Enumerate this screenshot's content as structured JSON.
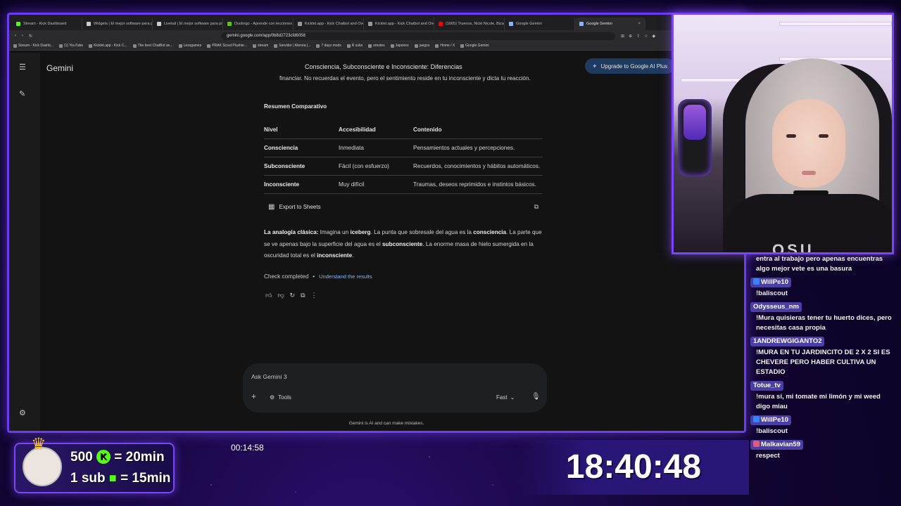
{
  "browser": {
    "tabs": [
      {
        "label": "Stream - Kick Dashboard",
        "color": "#53fc18"
      },
      {
        "label": "Widgets | El mejor software para pro",
        "color": "#cccccc"
      },
      {
        "label": "Livetail | El mejor software para prin",
        "color": "#cccccc"
      },
      {
        "label": "Duolingo - Aprende con lecciones d",
        "color": "#58cc02"
      },
      {
        "label": "Kicklet.app - Kick Chatbot and Overl",
        "color": "#999999"
      },
      {
        "label": "Kicklet.app - Kick Chatbot and Overl",
        "color": "#999999"
      },
      {
        "label": "(1665) Truenos, Nicki Nicole, Bizar",
        "color": "#ff0000"
      },
      {
        "label": "Google Gemini",
        "color": "#8ab4f8"
      },
      {
        "label": "Google Gemini",
        "color": "#8ab4f8",
        "active": true
      }
    ],
    "url": "gemini.google.com/app/0b8d2723cfd6058",
    "bookmarks": [
      "Stream - Kick Dashb...",
      "(1) YouTube",
      "Kicklet.app - Kick C...",
      "The best ChatBot an...",
      "Lessgames",
      "PRAK Scout Plushie...",
      "stream",
      "Servidor | Atenea |...",
      "7 days mods",
      "R subs",
      "emotes",
      "Japones",
      "juegos",
      "Home / X",
      "Google Gemini"
    ]
  },
  "gemini": {
    "app_name": "Gemini",
    "chat_title": "Consciencia, Subconsciente e Inconsciente: Diferencias",
    "upgrade_label": "Upgrade to Google AI Plus",
    "cut_text": "financiar. No recuerdas el evento, pero el sentimiento reside en tu inconsciente y dicta tu reacción.",
    "summary_heading": "Resumen Comparativo",
    "table": {
      "headers": [
        "Nivel",
        "Accesibilidad",
        "Contenido"
      ],
      "rows": [
        [
          "Consciencia",
          "Inmediata",
          "Pensamientos actuales y percepciones."
        ],
        [
          "Subconsciente",
          "Fácil (con esfuerzo)",
          "Recuerdos, conocimientos y hábitos automáticos."
        ],
        [
          "Inconsciente",
          "Muy difícil",
          "Traumas, deseos reprimidos e instintos básicos."
        ]
      ]
    },
    "export_label": "Export to Sheets",
    "analogy": {
      "lead": "La analogía clásica:",
      "p1": " Imagina un ",
      "b1": "iceberg",
      "p2": ". La punta que sobresale del agua es la ",
      "b2": "consciencia",
      "p3": ". La parte que se ve apenas bajo la superficie del agua es el ",
      "b3": "subconsciente",
      "p4": ". La enorme masa de hielo sumergida en la oscuridad total es el ",
      "b4": "inconsciente",
      "p5": "."
    },
    "check_status": "Check completed",
    "check_link": "Understand the results",
    "prompt_placeholder": "Ask Gemini 3",
    "tools_label": "Tools",
    "mode_label": "Fast",
    "disclaimer": "Gemini is AI and can make mistakes."
  },
  "chat": {
    "messages": [
      {
        "user": "",
        "text": "entra al trabajo pero apenas encuentras algo mejor vete es una basura"
      },
      {
        "user": "WillPe10",
        "text": "!baliscout",
        "badge": "#3b82f6"
      },
      {
        "user": "Odysseus_nm",
        "text": "!Mura quisieras tener tu huerto dices, pero necesitas casa propia"
      },
      {
        "user": "1ANDREWGIGANTO2",
        "text": "!MURA EN TU JARDINCITO DE 2 X 2 SI ES CHEVERE PERO HABER CULTIVA UN ESTADIO"
      },
      {
        "user": "Totue_tv",
        "text": "!mura sí, mi tomate mi limón y mi weed digo miau"
      },
      {
        "user": "WillPe10",
        "text": "!baliscout",
        "badge": "#3b82f6"
      },
      {
        "user": "Malkavian59",
        "text": "respect",
        "badge": "#e05a7a"
      }
    ]
  },
  "overlay": {
    "sub_line1_pre": "500",
    "sub_line1_post": "= 20min",
    "sub_line2_pre": "1 sub",
    "sub_line2_post": "= 15min",
    "stream_timer": "00:14:58",
    "clock": "18:40:48",
    "shirt_text": "OSU"
  },
  "colors": {
    "accent": "#7a44ff",
    "kick_green": "#53fc18",
    "link": "#8ab4f8"
  }
}
